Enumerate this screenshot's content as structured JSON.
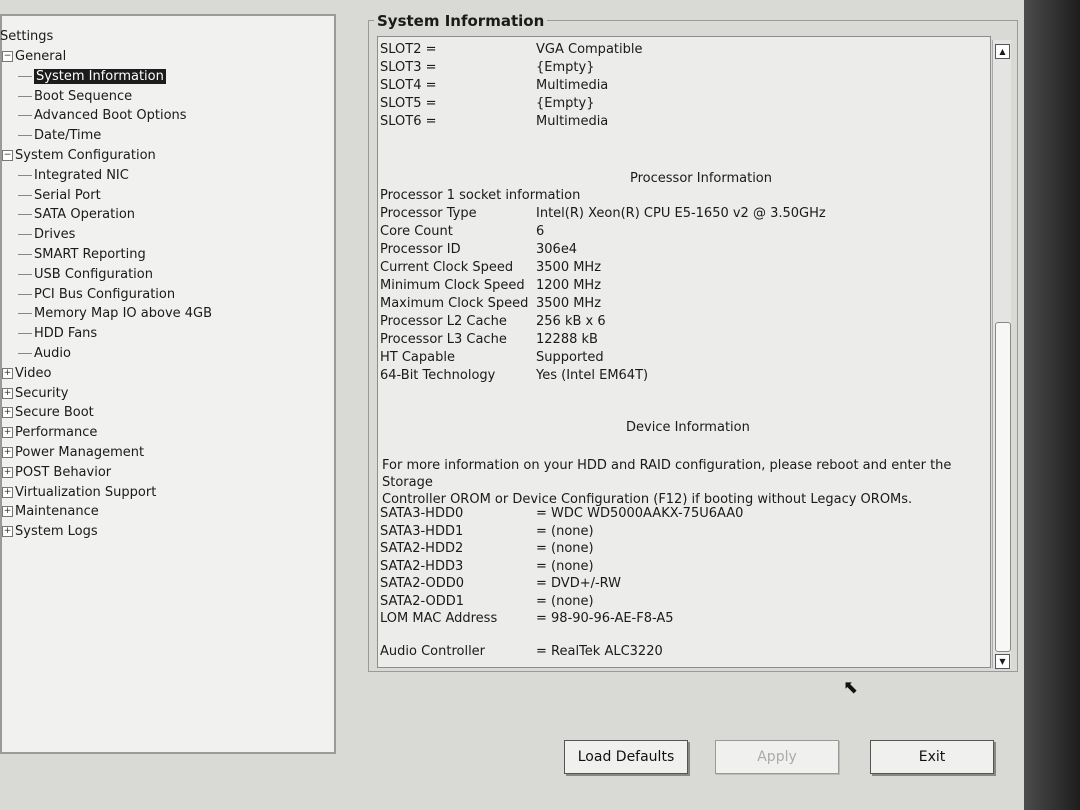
{
  "sidebar": {
    "root": "Settings",
    "items": [
      {
        "label": "General",
        "level": 0,
        "expander": "-"
      },
      {
        "label": "System Information",
        "level": 1,
        "selected": true
      },
      {
        "label": "Boot Sequence",
        "level": 1
      },
      {
        "label": "Advanced Boot Options",
        "level": 1
      },
      {
        "label": "Date/Time",
        "level": 1
      },
      {
        "label": "System Configuration",
        "level": 0,
        "expander": "-"
      },
      {
        "label": "Integrated NIC",
        "level": 1
      },
      {
        "label": "Serial Port",
        "level": 1
      },
      {
        "label": "SATA Operation",
        "level": 1
      },
      {
        "label": "Drives",
        "level": 1
      },
      {
        "label": "SMART Reporting",
        "level": 1
      },
      {
        "label": "USB Configuration",
        "level": 1
      },
      {
        "label": "PCI Bus Configuration",
        "level": 1
      },
      {
        "label": "Memory Map IO above 4GB",
        "level": 1
      },
      {
        "label": "HDD Fans",
        "level": 1
      },
      {
        "label": "Audio",
        "level": 1
      },
      {
        "label": "Video",
        "level": 0,
        "expander": "+"
      },
      {
        "label": "Security",
        "level": 0,
        "expander": "+"
      },
      {
        "label": "Secure Boot",
        "level": 0,
        "expander": "+"
      },
      {
        "label": "Performance",
        "level": 0,
        "expander": "+"
      },
      {
        "label": "Power Management",
        "level": 0,
        "expander": "+"
      },
      {
        "label": "POST Behavior",
        "level": 0,
        "expander": "+"
      },
      {
        "label": "Virtualization Support",
        "level": 0,
        "expander": "+"
      },
      {
        "label": "Maintenance",
        "level": 0,
        "expander": "+"
      },
      {
        "label": "System Logs",
        "level": 0,
        "expander": "+"
      }
    ]
  },
  "main": {
    "title": "System Information",
    "slots": [
      {
        "key": "SLOT2 =",
        "value": "VGA Compatible"
      },
      {
        "key": "SLOT3 =",
        "value": "{Empty}"
      },
      {
        "key": "SLOT4 =",
        "value": "Multimedia"
      },
      {
        "key": "SLOT5 =",
        "value": "{Empty}"
      },
      {
        "key": "SLOT6 =",
        "value": "Multimedia"
      }
    ],
    "processor_title": "Processor Information",
    "processor_socket": "Processor 1 socket information",
    "processor": [
      {
        "key": "Processor Type",
        "value": "Intel(R) Xeon(R) CPU E5-1650 v2 @ 3.50GHz"
      },
      {
        "key": "Core Count",
        "value": "6"
      },
      {
        "key": "Processor ID",
        "value": "306e4"
      },
      {
        "key": "Current Clock Speed",
        "value": "3500 MHz"
      },
      {
        "key": "Minimum Clock Speed",
        "value": "1200 MHz"
      },
      {
        "key": "Maximum Clock Speed",
        "value": "3500 MHz"
      },
      {
        "key": "Processor L2 Cache",
        "value": "256 kB x 6"
      },
      {
        "key": "Processor L3 Cache",
        "value": "12288 kB"
      },
      {
        "key": "HT Capable",
        "value": "Supported"
      },
      {
        "key": "64-Bit Technology",
        "value": "Yes (Intel EM64T)"
      }
    ],
    "device_title": "Device Information",
    "device_note_1": "For more information on your HDD and RAID configuration, please reboot and enter the Storage",
    "device_note_2": "Controller OROM or Device Configuration (F12) if booting without Legacy OROMs.",
    "devices": [
      {
        "key": "SATA3-HDD0",
        "value": "= WDC WD5000AAKX-75U6AA0"
      },
      {
        "key": "SATA3-HDD1",
        "value": "= (none)"
      },
      {
        "key": "SATA2-HDD2",
        "value": "= (none)"
      },
      {
        "key": "SATA2-HDD3",
        "value": "= (none)"
      },
      {
        "key": "SATA2-ODD0",
        "value": "= DVD+/-RW"
      },
      {
        "key": "SATA2-ODD1",
        "value": "= (none)"
      },
      {
        "key": "LOM MAC Address",
        "value": "= 98-90-96-AE-F8-A5"
      }
    ],
    "audio": {
      "key": "Audio Controller",
      "value": "= RealTek ALC3220"
    }
  },
  "buttons": {
    "load_defaults": "Load Defaults",
    "apply": "Apply",
    "exit": "Exit"
  }
}
